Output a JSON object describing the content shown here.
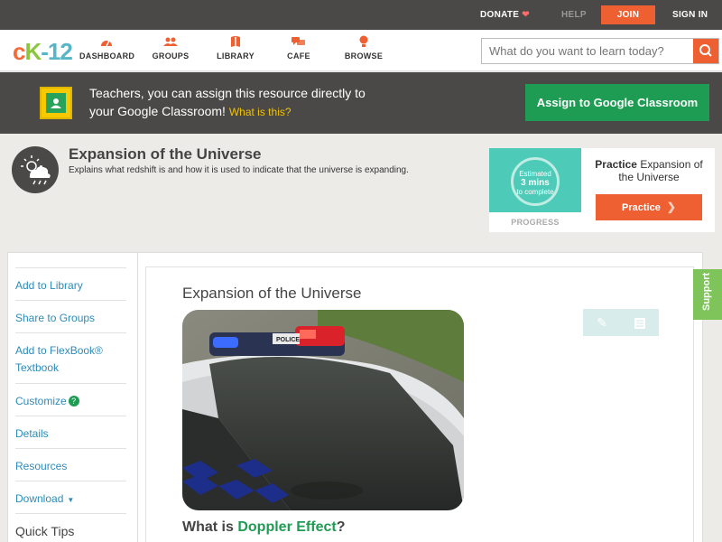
{
  "topbar": {
    "donate": "DONATE",
    "help": "HELP",
    "join": "JOIN",
    "signin": "SIGN IN"
  },
  "logo": {
    "c": "c",
    "k": "K",
    "n": "-12"
  },
  "nav": [
    {
      "label": "DASHBOARD",
      "icon": "dashboard-icon"
    },
    {
      "label": "GROUPS",
      "icon": "groups-icon"
    },
    {
      "label": "LIBRARY",
      "icon": "library-icon"
    },
    {
      "label": "CAFE",
      "icon": "cafe-icon"
    },
    {
      "label": "BROWSE",
      "icon": "browse-icon"
    }
  ],
  "search": {
    "placeholder": "What do you want to learn today?"
  },
  "classroom": {
    "line1": "Teachers, you can assign this resource directly to",
    "line2": "your Google Classroom!",
    "what": "What is this?",
    "button": "Assign to Google Classroom"
  },
  "header": {
    "title": "Expansion of the Universe",
    "description": "Explains what redshift is and how it is used to indicate that the universe is expanding."
  },
  "practice": {
    "estimated": "Estimated",
    "mins": "3 mins",
    "complete": "to complete",
    "progress": "PROGRESS",
    "bold": "Practice",
    "topic": "Expansion of the Universe",
    "button": "Practice"
  },
  "sidebar": {
    "items": [
      "Add to Library",
      "Share to Groups",
      "Add to FlexBook®",
      "Textbook",
      "Customize",
      "Details",
      "Resources",
      "Download",
      "Quick Tips"
    ]
  },
  "article": {
    "title": "Expansion of the Universe",
    "what_is": "What is",
    "term": "Doppler Effect",
    "q": "?"
  },
  "support": "Support",
  "colors": {
    "accent": "#ee5f31",
    "green": "#1e9c53",
    "link": "#2e8bb7",
    "dark_bar": "#4a4947"
  }
}
